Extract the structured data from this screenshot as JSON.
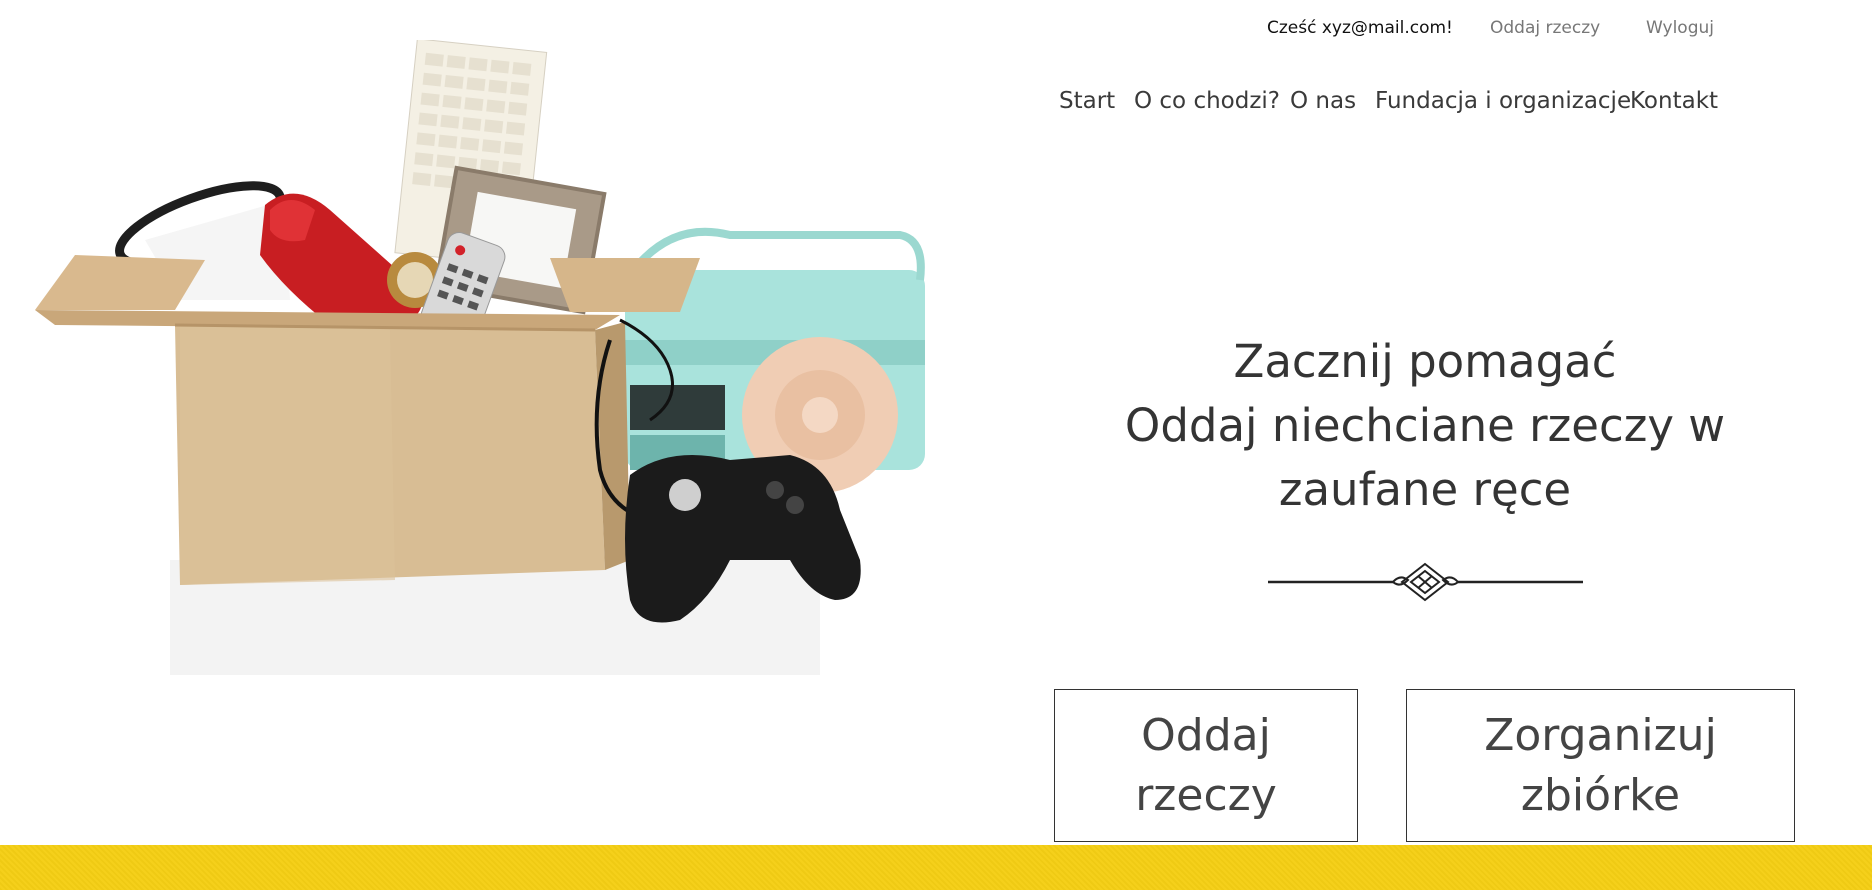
{
  "user_bar": {
    "greeting": "Cześć xyz@mail.com!",
    "give_link": "Oddaj rzeczy",
    "logout_link": "Wyloguj"
  },
  "nav": {
    "items": [
      "Start",
      "O co chodzi?",
      "O nas",
      "Fundacja i organizacje",
      "Kontakt"
    ]
  },
  "hero": {
    "headline_lines": [
      "Zacznij pomagać",
      "Oddaj niechciane rzeczy w",
      "zaufane ręce"
    ],
    "image_icon": "box-of-unwanted-items-illustration"
  },
  "cta": {
    "give_lines": [
      "Oddaj",
      "rzeczy"
    ],
    "organize_lines": [
      "Zorganizuj",
      "zbiórke"
    ]
  },
  "colors": {
    "accent_yellow": "#f5cf14",
    "text_dark": "#343434",
    "link_gray": "#777777"
  }
}
